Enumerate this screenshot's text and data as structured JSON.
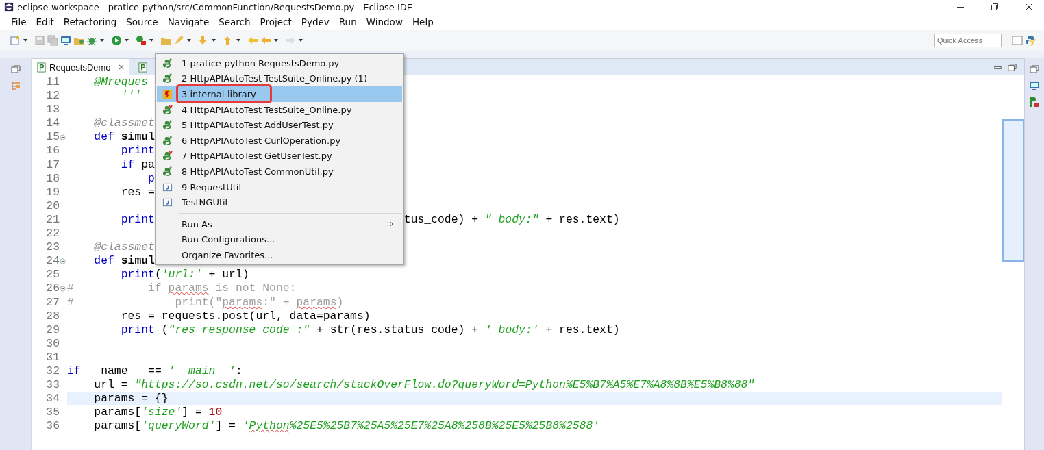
{
  "window": {
    "title": "eclipse-workspace - pratice-python/src/CommonFunction/RequestsDemo.py - Eclipse IDE"
  },
  "menubar": [
    "File",
    "Edit",
    "Refactoring",
    "Source",
    "Navigate",
    "Search",
    "Project",
    "Pydev",
    "Run",
    "Window",
    "Help"
  ],
  "quick_access": {
    "placeholder": "Quick Access"
  },
  "editor_tabs": [
    {
      "label": "RequestsDemo",
      "selected": true
    },
    {
      "selected": false
    }
  ],
  "code_lines": [
    {
      "number": "11",
      "fold": false,
      "current": false,
      "tokens": [
        {
          "text": "    @Mreques",
          "kind": "string"
        }
      ]
    },
    {
      "number": "12",
      "fold": false,
      "current": false,
      "tokens": [
        {
          "text": "        '''",
          "kind": "string"
        }
      ]
    },
    {
      "number": "13",
      "fold": false,
      "current": false
    },
    {
      "number": "14",
      "fold": false,
      "current": false,
      "tokens": [
        {
          "text": "    @classmet",
          "kind": "decorator"
        }
      ]
    },
    {
      "number": "15",
      "fold": true,
      "current": false,
      "tokens": [
        {
          "text": "    def ",
          "kind": "keyword"
        },
        {
          "text": "simul",
          "kind": "defname"
        }
      ]
    },
    {
      "number": "16",
      "fold": false,
      "current": false,
      "tokens": [
        {
          "text": "        print",
          "kind": "keyword"
        }
      ]
    },
    {
      "number": "17",
      "fold": false,
      "current": false,
      "tokens": [
        {
          "text": "        if ",
          "kind": "keyword"
        },
        {
          "text": "pa",
          "kind": "plain"
        }
      ]
    },
    {
      "number": "18",
      "fold": false,
      "current": false,
      "tokens": [
        {
          "text": "            p",
          "kind": "keyword"
        }
      ]
    },
    {
      "number": "19",
      "fold": false,
      "current": false,
      "tokens": [
        {
          "text": "        res =",
          "kind": "plain"
        }
      ]
    },
    {
      "number": "20",
      "fold": false,
      "current": false
    },
    {
      "number": "21",
      "fold": false,
      "current": false,
      "tokens": [
        {
          "text": "        print",
          "kind": "keyword"
        }
      ],
      "right_tokens": [
        {
          "text": "tus_code) + ",
          "kind": "plain"
        },
        {
          "text": "\" body:\"",
          "kind": "string"
        },
        {
          "text": " + res.text)",
          "kind": "plain"
        }
      ]
    },
    {
      "number": "22",
      "fold": false,
      "current": false
    },
    {
      "number": "23",
      "fold": false,
      "current": false,
      "tokens": [
        {
          "text": "    @classmet",
          "kind": "decorator"
        }
      ]
    },
    {
      "number": "24",
      "fold": true,
      "current": false,
      "tokens": [
        {
          "text": "    def ",
          "kind": "keyword"
        },
        {
          "text": "simul",
          "kind": "defname"
        }
      ]
    },
    {
      "number": "25",
      "fold": false,
      "current": false,
      "tokens": [
        {
          "text": "        print",
          "kind": "keyword"
        },
        {
          "text": "(",
          "kind": "plain"
        },
        {
          "text": "'url:'",
          "kind": "string"
        },
        {
          "text": " + url)",
          "kind": "plain"
        }
      ]
    },
    {
      "number": "26",
      "fold": true,
      "current": false,
      "tokens": [
        {
          "text": "#           if ",
          "kind": "comment"
        },
        {
          "text": "params",
          "kind": "comment",
          "spell_error": true
        },
        {
          "text": " is not None:",
          "kind": "comment"
        }
      ]
    },
    {
      "number": "27",
      "fold": false,
      "current": false,
      "tokens": [
        {
          "text": "#               print(\"",
          "kind": "comment"
        },
        {
          "text": "params",
          "kind": "comment",
          "spell_error": true
        },
        {
          "text": ":\" + ",
          "kind": "comment"
        },
        {
          "text": "params",
          "kind": "comment",
          "spell_error": true
        },
        {
          "text": ")",
          "kind": "comment"
        }
      ]
    },
    {
      "number": "28",
      "fold": false,
      "current": false,
      "tokens": [
        {
          "text": "        res = requests.post(url, data=params)",
          "kind": "plain"
        }
      ]
    },
    {
      "number": "29",
      "fold": false,
      "current": false,
      "tokens": [
        {
          "text": "        print",
          "kind": "keyword"
        },
        {
          "text": " (",
          "kind": "plain"
        },
        {
          "text": "\"res response code :\"",
          "kind": "string"
        },
        {
          "text": " + str(res.status_code) + ",
          "kind": "plain"
        },
        {
          "text": "' body:'",
          "kind": "string"
        },
        {
          "text": " + res.text)",
          "kind": "plain"
        }
      ]
    },
    {
      "number": "30",
      "fold": false,
      "current": false
    },
    {
      "number": "31",
      "fold": false,
      "current": false
    },
    {
      "number": "32",
      "fold": false,
      "current": false,
      "tokens": [
        {
          "text": "if",
          "kind": "keyword"
        },
        {
          "text": " __name__ == ",
          "kind": "plain"
        },
        {
          "text": "'__main__'",
          "kind": "string"
        },
        {
          "text": ":",
          "kind": "plain"
        }
      ]
    },
    {
      "number": "33",
      "fold": false,
      "current": false,
      "tokens": [
        {
          "text": "    url = ",
          "kind": "plain"
        },
        {
          "text": "\"https://so.csdn.net/so/search/stackOverFlow.do?queryWord=Python%E5%B7%A5%E7%A8%8B%E5%B8%88\"",
          "kind": "string"
        }
      ]
    },
    {
      "number": "34",
      "fold": false,
      "current": true,
      "tokens": [
        {
          "text": "    params = {}",
          "kind": "plain"
        }
      ]
    },
    {
      "number": "35",
      "fold": false,
      "current": false,
      "tokens": [
        {
          "text": "    params[",
          "kind": "plain"
        },
        {
          "text": "'size'",
          "kind": "string"
        },
        {
          "text": "] = ",
          "kind": "plain"
        },
        {
          "text": "10",
          "kind": "number"
        }
      ]
    },
    {
      "number": "36",
      "fold": false,
      "current": false,
      "tokens": [
        {
          "text": "    params[",
          "kind": "plain"
        },
        {
          "text": "'queryWord'",
          "kind": "string"
        },
        {
          "text": "] = ",
          "kind": "plain"
        },
        {
          "text": "'",
          "kind": "string"
        },
        {
          "text": "Python",
          "kind": "string",
          "spell_error": true
        },
        {
          "text": "%25E5%25B7%25A5%25E7%25A8%258B%25E5%25B8%2588'",
          "kind": "string"
        }
      ]
    }
  ],
  "run_menu": {
    "items": [
      {
        "kind": "item",
        "label": "1 pratice-python RequestsDemo.py",
        "selected": false,
        "submenu": false
      },
      {
        "kind": "item",
        "label": "2 HttpAPIAutoTest TestSuite_Online.py (1)",
        "selected": false,
        "submenu": false
      },
      {
        "kind": "item",
        "label": "3 internal-library",
        "selected": true,
        "submenu": false
      },
      {
        "kind": "item",
        "label": "4 HttpAPIAutoTest TestSuite_Online.py",
        "selected": false,
        "submenu": false
      },
      {
        "kind": "item",
        "label": "5 HttpAPIAutoTest AddUserTest.py",
        "selected": false,
        "submenu": false
      },
      {
        "kind": "item",
        "label": "6 HttpAPIAutoTest CurlOperation.py",
        "selected": false,
        "submenu": false
      },
      {
        "kind": "item",
        "label": "7 HttpAPIAutoTest GetUserTest.py",
        "selected": false,
        "submenu": false
      },
      {
        "kind": "item",
        "label": "8 HttpAPIAutoTest CommonUtil.py",
        "selected": false,
        "submenu": false
      },
      {
        "kind": "item",
        "label": "9 RequestUtil",
        "selected": false,
        "submenu": false
      },
      {
        "kind": "item",
        "label": "TestNGUtil",
        "selected": false,
        "submenu": false
      },
      {
        "kind": "separator"
      },
      {
        "kind": "item",
        "label": "Run As",
        "selected": false,
        "submenu": true
      },
      {
        "kind": "item",
        "label": "Run Configurations...",
        "selected": false,
        "submenu": false
      },
      {
        "kind": "item",
        "label": "Organize Favorites...",
        "selected": false,
        "submenu": false
      }
    ]
  }
}
